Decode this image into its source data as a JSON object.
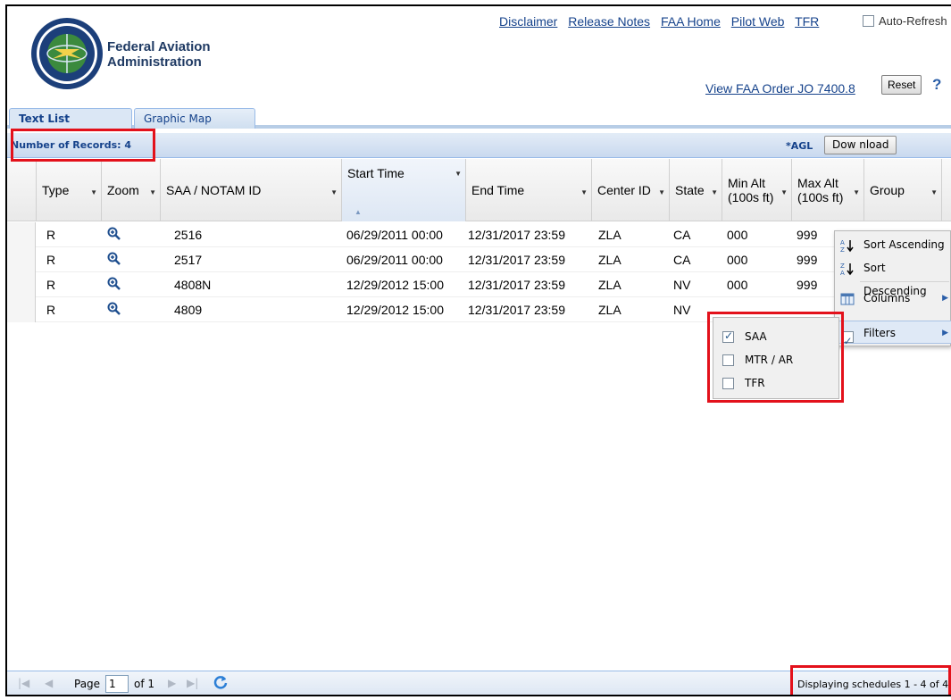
{
  "org": {
    "line1": "Federal Aviation",
    "line2": "Administration"
  },
  "toplinks": [
    "Disclaimer",
    "Release Notes",
    "FAA Home",
    "Pilot Web",
    "TFR"
  ],
  "auto_refresh_label": "Auto-Refresh",
  "order_link": "View FAA Order JO 7400.8",
  "reset_label": "Reset",
  "help_glyph": "?",
  "tabs": [
    {
      "label": "Text List"
    },
    {
      "label": "Graphic Map"
    }
  ],
  "toolbar": {
    "records_label": "Number of Records: 4",
    "agl_label": "*AGL",
    "download_label": "Dow nload"
  },
  "columns": [
    "Type",
    "Zoom",
    "SAA / NOTAM ID",
    "Start Time",
    "End Time",
    "Center ID",
    "State",
    "Min Alt (100s ft)",
    "Max Alt (100s ft)",
    "Group"
  ],
  "col_min_alt": {
    "l1": "Min Alt",
    "l2": "(100s ft)"
  },
  "col_max_alt": {
    "l1": "Max Alt",
    "l2": "(100s ft)"
  },
  "rows": [
    {
      "type": "R",
      "id": "2516",
      "start": "06/29/2011 00:00",
      "end": "12/31/2017 23:59",
      "center": "ZLA",
      "state": "CA",
      "min": "000",
      "max": "999"
    },
    {
      "type": "R",
      "id": "2517",
      "start": "06/29/2011 00:00",
      "end": "12/31/2017 23:59",
      "center": "ZLA",
      "state": "CA",
      "min": "000",
      "max": "999"
    },
    {
      "type": "R",
      "id": "4808N",
      "start": "12/29/2012 15:00",
      "end": "12/31/2017 23:59",
      "center": "ZLA",
      "state": "NV",
      "min": "000",
      "max": "999"
    },
    {
      "type": "R",
      "id": "4809",
      "start": "12/29/2012 15:00",
      "end": "12/31/2017 23:59",
      "center": "ZLA",
      "state": "NV",
      "min": "",
      "max": ""
    }
  ],
  "column_menu": {
    "sort_asc": "Sort Ascending",
    "sort_desc": "Sort Descending",
    "columns": "Columns",
    "filters": "Filters"
  },
  "filter_menu": [
    {
      "label": "SAA",
      "checked": true
    },
    {
      "label": "MTR / AR",
      "checked": false
    },
    {
      "label": "TFR",
      "checked": false
    }
  ],
  "pager": {
    "page_label": "Page",
    "page_value": "1",
    "of_label": "of 1",
    "display_msg": "Displaying schedules 1 - 4 of 4"
  },
  "colors": {
    "accent": "#15428b",
    "highlight": "#e3111b"
  }
}
